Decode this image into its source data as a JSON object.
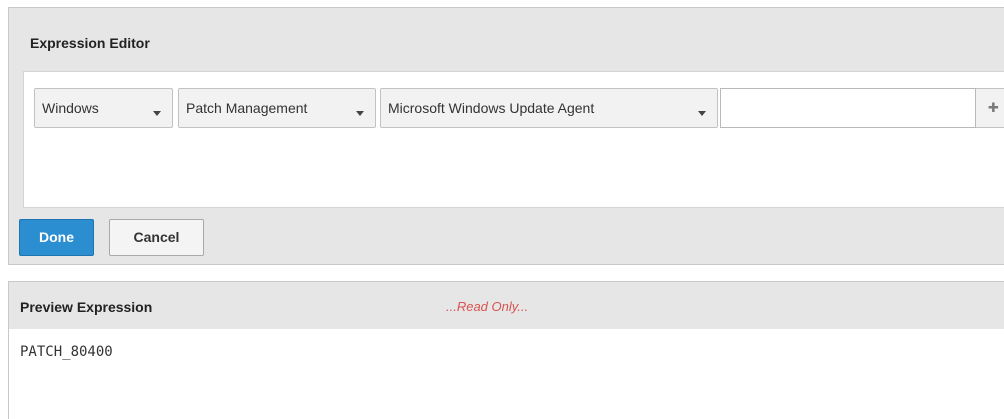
{
  "expression_editor": {
    "title": "Expression Editor",
    "dropdowns": [
      {
        "value": "Windows"
      },
      {
        "value": "Patch Management"
      },
      {
        "value": "Microsoft Windows Update Agent"
      }
    ],
    "value_input": {
      "value": "",
      "placeholder": ""
    },
    "add_icon": "plus-icon",
    "done_label": "Done",
    "cancel_label": "Cancel"
  },
  "preview": {
    "title": "Preview Expression",
    "status": "...Read Only...",
    "expression": "PATCH_80400"
  },
  "colors": {
    "primary": "#2a8ed0",
    "readonly_text": "#d9534f",
    "panel_bg": "#e6e6e6"
  }
}
